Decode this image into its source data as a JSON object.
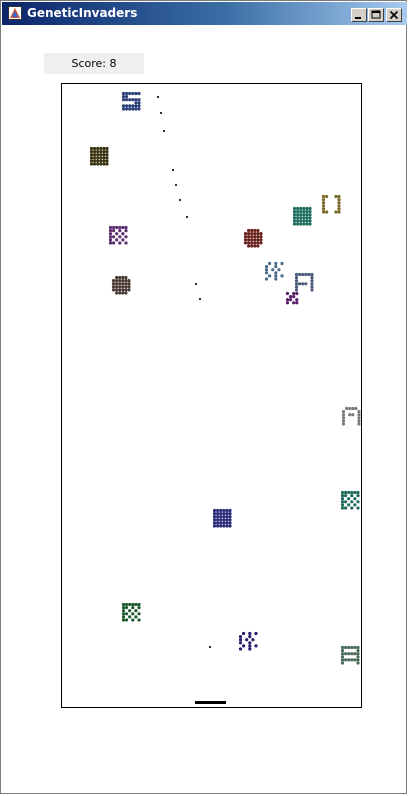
{
  "window": {
    "title": "GeneticInvaders",
    "buttons": [
      "minimize-icon",
      "maximize-icon",
      "close-icon"
    ],
    "titlebar_gradient": [
      "#0a246a",
      "#a6caf0"
    ]
  },
  "score": {
    "label": "Score: 8"
  },
  "game": {
    "invaders": [
      {
        "name": "invader-1",
        "color": "#2d3f7a"
      },
      {
        "name": "invader-2",
        "color": "#3a3310"
      },
      {
        "name": "invader-3",
        "color": "#5a2d6e"
      },
      {
        "name": "invader-4",
        "color": "#4a3b36"
      },
      {
        "name": "invader-5",
        "color": "#1e6e5e"
      },
      {
        "name": "invader-6",
        "color": "#7a6a2a"
      },
      {
        "name": "invader-7",
        "color": "#6a2420"
      },
      {
        "name": "invader-8",
        "color": "#4a6a8a"
      },
      {
        "name": "invader-9",
        "color": "#4a5a7a"
      },
      {
        "name": "invader-10",
        "color": "#5a1a6a"
      },
      {
        "name": "invader-11",
        "color": "#7a7a7a"
      },
      {
        "name": "invader-12",
        "color": "#1e6a5a"
      },
      {
        "name": "invader-13",
        "color": "#2a2a7a"
      },
      {
        "name": "invader-14",
        "color": "#1e5a2e"
      },
      {
        "name": "invader-15",
        "color": "#2a1a6a"
      },
      {
        "name": "invader-16",
        "color": "#4a6a5a"
      }
    ],
    "player_color": "#000000",
    "bullet_color": "#333333"
  }
}
